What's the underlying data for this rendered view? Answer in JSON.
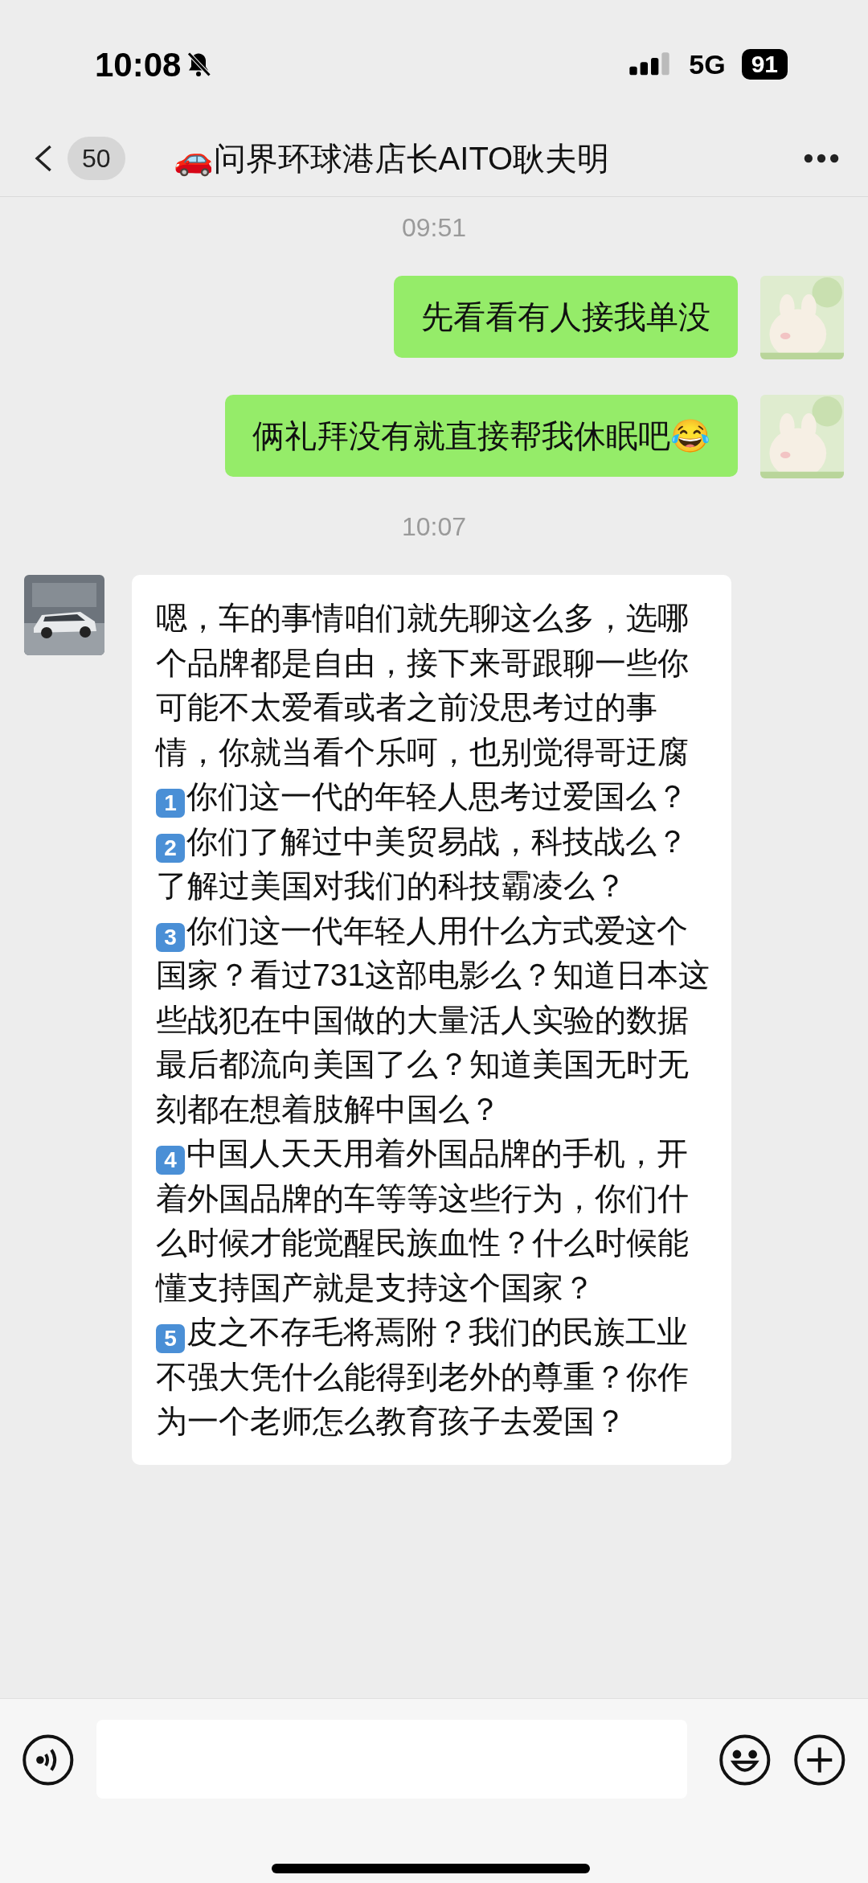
{
  "status_bar": {
    "time": "10:08",
    "silent": true,
    "network": "5G",
    "battery": "91"
  },
  "header": {
    "unread_count": "50",
    "title": "🚗问界环球港店长AITO耿夫明"
  },
  "messages": [
    {
      "kind": "time",
      "text": "09:51"
    },
    {
      "kind": "sent",
      "text": "先看看有人接我单没"
    },
    {
      "kind": "sent",
      "text": "俩礼拜没有就直接帮我休眠吧😂"
    },
    {
      "kind": "time",
      "text": "10:07"
    },
    {
      "kind": "received",
      "paragraphs": [
        {
          "text": "嗯，车的事情咱们就先聊这么多，选哪个品牌都是自由，接下来哥跟聊一些你可能不太爱看或者之前没思考过的事情，你就当看个乐呵，也别觉得哥迂腐"
        },
        {
          "number": "1",
          "text": "你们这一代的年轻人思考过爱国么？"
        },
        {
          "number": "2",
          "text": "你们了解过中美贸易战，科技战么？了解过美国对我们的科技霸凌么？"
        },
        {
          "number": "3",
          "text": "你们这一代年轻人用什么方式爱这个国家？看过731这部电影么？知道日本这些战犯在中国做的大量活人实验的数据最后都流向美国了么？知道美国无时无刻都在想着肢解中国么？"
        },
        {
          "number": "4",
          "text": "中国人天天用着外国品牌的手机，开着外国品牌的车等等这些行为，你们什么时候才能觉醒民族血性？什么时候能懂支持国产就是支持这个国家？"
        },
        {
          "number": "5",
          "text": "皮之不存毛将焉附？我们的民族工业不强大凭什么能得到老外的尊重？你作为一个老师怎么教育孩子去爱国？"
        }
      ]
    }
  ]
}
